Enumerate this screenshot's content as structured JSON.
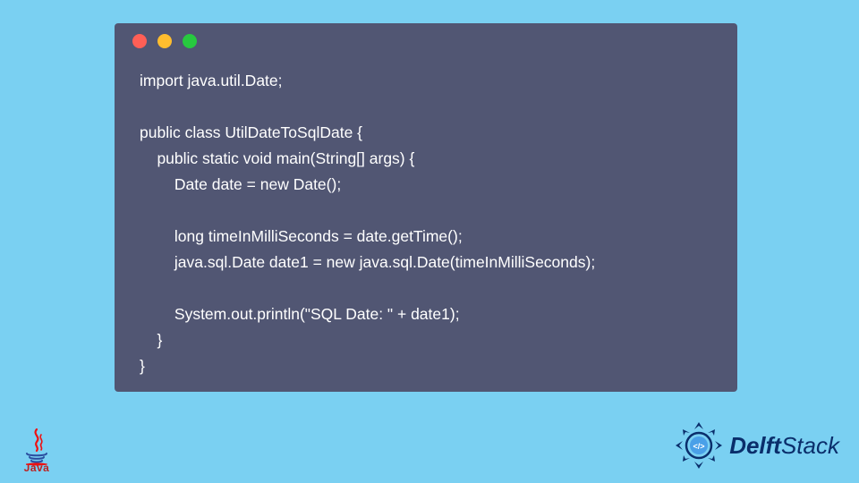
{
  "colors": {
    "background": "#7ad0f2",
    "editor_bg": "#515673",
    "code_text": "#ffffff",
    "dot_red": "#ff5f56",
    "dot_yellow": "#ffbd2e",
    "dot_green": "#27c93f"
  },
  "code": {
    "lines": [
      "import java.util.Date;",
      "",
      "public class UtilDateToSqlDate {",
      "    public static void main(String[] args) {",
      "        Date date = new Date();",
      "",
      "        long timeInMilliSeconds = date.getTime();",
      "        java.sql.Date date1 = new java.sql.Date(timeInMilliSeconds);",
      "",
      "        System.out.println(\"SQL Date: \" + date1);",
      "    }",
      "}"
    ]
  },
  "logos": {
    "java_label": "Java",
    "delft_brand_bold": "Delft",
    "delft_brand_light": "Stack",
    "delft_icon_glyph": "</>"
  }
}
